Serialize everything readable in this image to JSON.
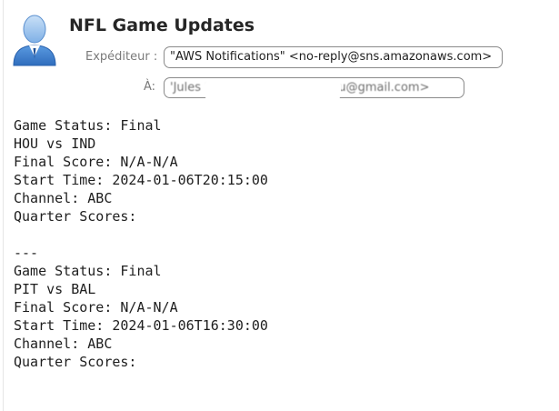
{
  "header": {
    "subject": "NFL Game Updates",
    "from_label": "Expéditeur :",
    "from_value": "\"AWS Notifications\" <no-reply@sns.amazonaws.com>",
    "to_label": "À:",
    "to_value": "'Jules Selledue' <jules.selledu@gmail.com>"
  },
  "body": {
    "lines": [
      "Game Status: Final",
      "HOU vs IND",
      "Final Score: N/A-N/A",
      "Start Time: 2024-01-06T20:15:00",
      "Channel: ABC",
      "Quarter Scores:",
      "",
      "---",
      "Game Status: Final",
      "PIT vs BAL",
      "Final Score: N/A-N/A",
      "Start Time: 2024-01-06T16:30:00",
      "Channel: ABC",
      "Quarter Scores:"
    ]
  },
  "colors": {
    "avatar_blue": "#3b7fd0",
    "avatar_light": "#9cc4ee",
    "pill_border": "#8a8a8a",
    "label_gray": "#7a7a7a"
  },
  "icons": {
    "avatar": "person-avatar-icon"
  }
}
